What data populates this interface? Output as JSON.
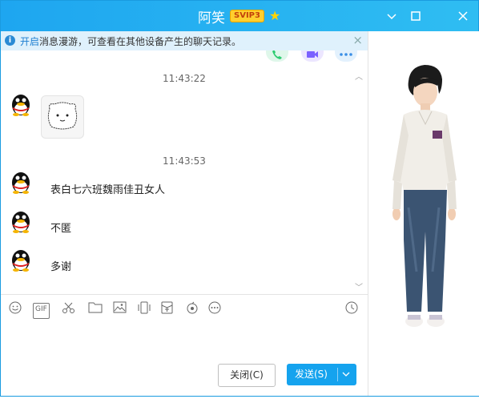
{
  "window": {
    "title": "阿笑",
    "vip_badge": "SVIP3"
  },
  "notice": {
    "link": "开启",
    "text": "消息漫游，可查看在其他设备产生的聊天记录。"
  },
  "messages": [
    {
      "time": "11:43:22",
      "text": ""
    },
    {
      "time": "11:43:53",
      "text": "表白七六班魏雨佳丑女人"
    },
    {
      "time": "",
      "text": "不匿"
    },
    {
      "time": "",
      "text": "多谢"
    }
  ],
  "buttons": {
    "close": "关闭(C)",
    "send": "发送(S)"
  },
  "icons": {
    "phone": "phone-icon",
    "video": "video-icon",
    "more": "more-icon",
    "emoji": "emoji-icon",
    "gif": "GIF",
    "scissors": "scissors-icon",
    "folder": "folder-icon",
    "image": "image-icon",
    "shake": "shake-icon",
    "redpacket": "red-packet-icon",
    "music": "music-icon",
    "more_tools": "more-tools-icon",
    "history": "history-clock-icon"
  },
  "colors": {
    "titlebar": "#1ea6f0",
    "send_button": "#15a3ee",
    "link": "#1d7fd1"
  }
}
